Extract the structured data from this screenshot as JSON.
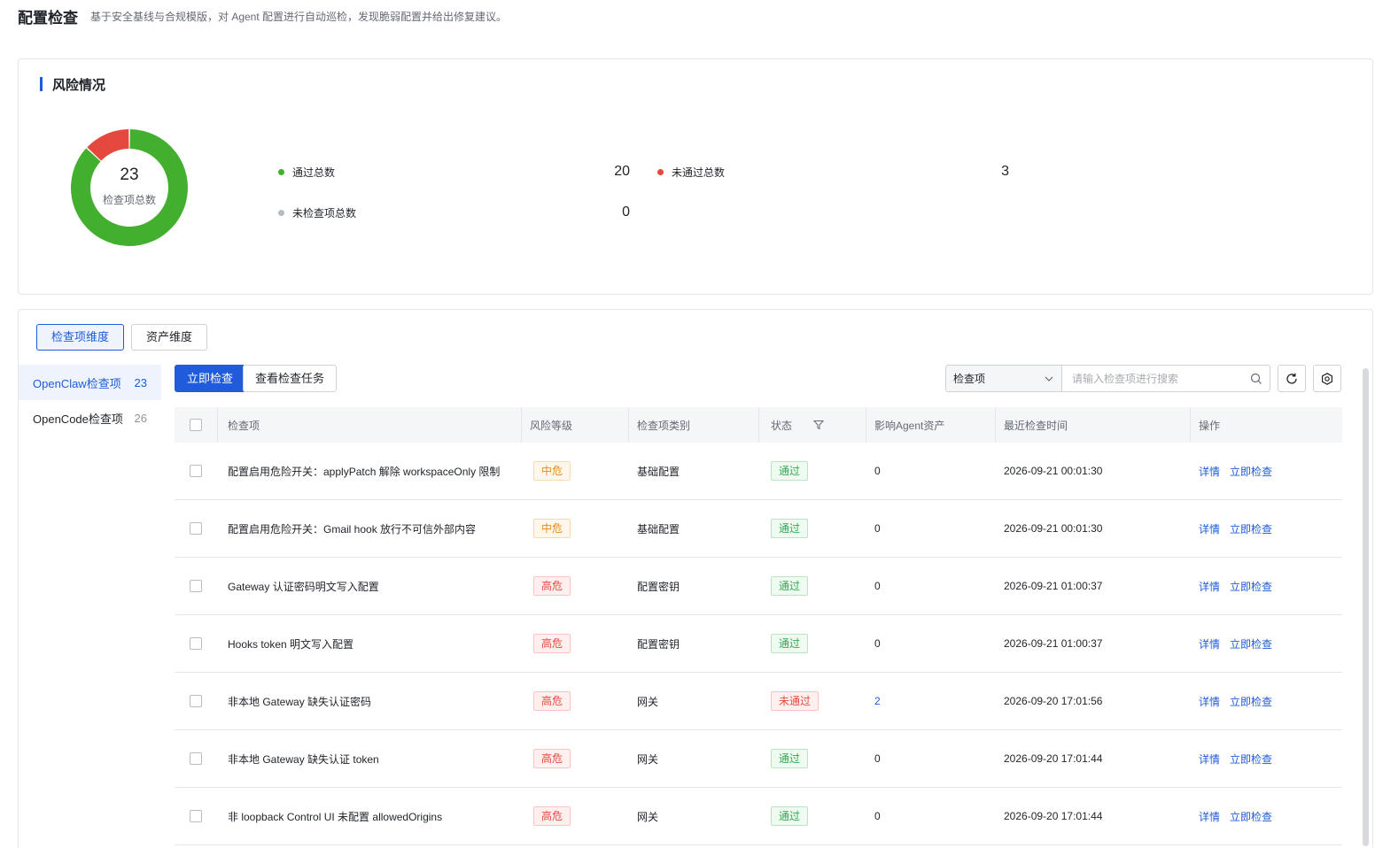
{
  "header": {
    "title": "配置检查",
    "description": "基于安全基线与合规模版，对 Agent 配置进行自动巡检，发现脆弱配置并给出修复建议。"
  },
  "risk": {
    "section_title": "风险情况",
    "total": "23",
    "total_caption": "检查项总数",
    "passed_label": "通过总数",
    "passed_value": "20",
    "failed_label": "未通过总数",
    "failed_value": "3",
    "unchecked_label": "未检查项总数",
    "unchecked_value": "0",
    "colors": {
      "passed": "#42b02e",
      "failed": "#e5483d",
      "unchecked": "#b7bbc2"
    }
  },
  "tabs": [
    {
      "label": "检查项维度",
      "active": true
    },
    {
      "label": "资产维度",
      "active": false
    }
  ],
  "sidebar": {
    "items": [
      {
        "label": "OpenClaw检查项",
        "count": "23",
        "active": true
      },
      {
        "label": "OpenCode检查项",
        "count": "26",
        "active": false
      }
    ]
  },
  "toolbar": {
    "check_now_label": "立即检查",
    "view_tasks_label": "查看检查任务",
    "search_scope": "检查项",
    "search_placeholder": "请输入检查项进行搜索",
    "refresh_icon": "refresh-icon",
    "settings_icon": "settings-icon"
  },
  "table": {
    "columns": [
      "检查项",
      "风险等级",
      "检查项类别",
      "状态",
      "影响Agent资产",
      "最近检查时间",
      "操作"
    ],
    "detail_label": "详情",
    "recheck_label": "立即检查",
    "rows": [
      {
        "name": "配置启用危险开关：applyPatch 解除 workspaceOnly 限制",
        "level": "中危",
        "level_type": "mid",
        "category": "基础配置",
        "status": "通过",
        "status_type": "pass",
        "assets": "0",
        "time": "2026-09-21 00:01:30"
      },
      {
        "name": "配置启用危险开关：Gmail hook 放行不可信外部内容",
        "level": "中危",
        "level_type": "mid",
        "category": "基础配置",
        "status": "通过",
        "status_type": "pass",
        "assets": "0",
        "time": "2026-09-21 00:01:30"
      },
      {
        "name": "Gateway 认证密码明文写入配置",
        "level": "高危",
        "level_type": "high",
        "category": "配置密钥",
        "status": "通过",
        "status_type": "pass",
        "assets": "0",
        "time": "2026-09-21 01:00:37"
      },
      {
        "name": "Hooks token 明文写入配置",
        "level": "高危",
        "level_type": "high",
        "category": "配置密钥",
        "status": "通过",
        "status_type": "pass",
        "assets": "0",
        "time": "2026-09-21 01:00:37"
      },
      {
        "name": "非本地 Gateway 缺失认证密码",
        "level": "高危",
        "level_type": "high",
        "category": "网关",
        "status": "未通过",
        "status_type": "fail",
        "assets": "2",
        "time": "2026-09-20 17:01:56"
      },
      {
        "name": "非本地 Gateway 缺失认证 token",
        "level": "高危",
        "level_type": "high",
        "category": "网关",
        "status": "通过",
        "status_type": "pass",
        "assets": "0",
        "time": "2026-09-20 17:01:44"
      },
      {
        "name": "非 loopback Control UI 未配置 allowedOrigins",
        "level": "高危",
        "level_type": "high",
        "category": "网关",
        "status": "通过",
        "status_type": "pass",
        "assets": "0",
        "time": "2026-09-20 17:01:44"
      }
    ]
  }
}
